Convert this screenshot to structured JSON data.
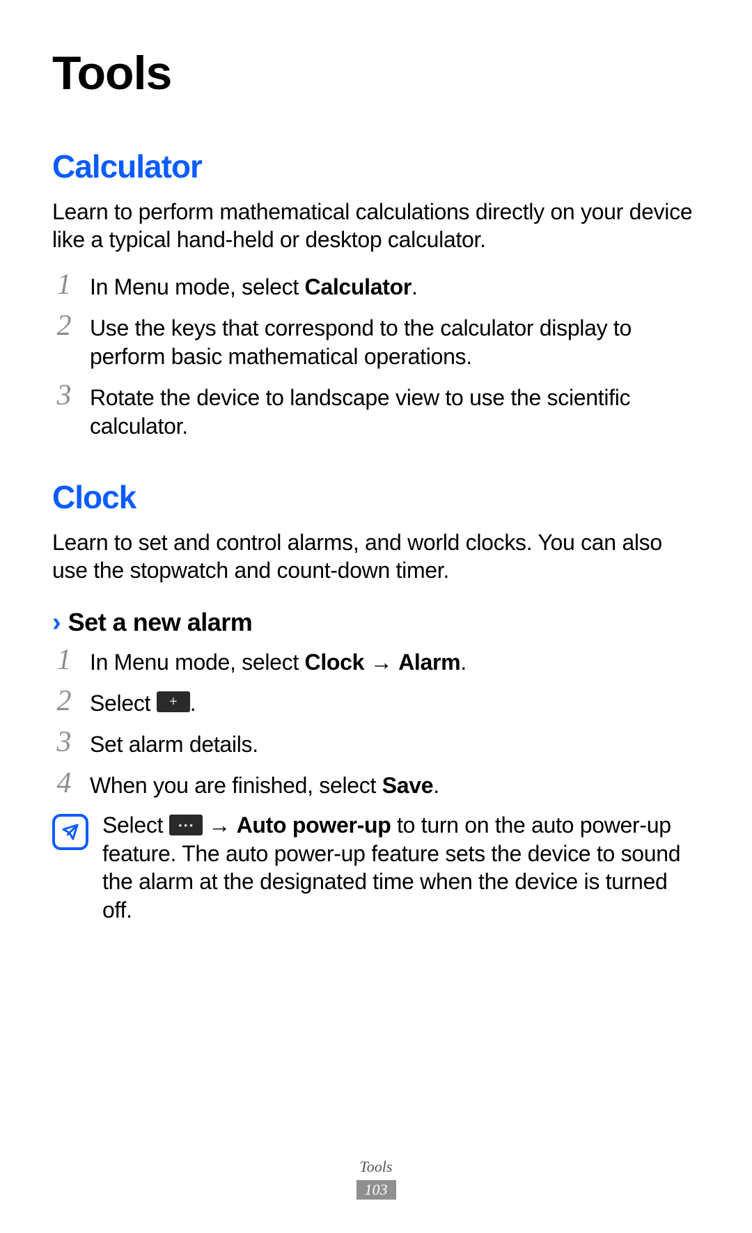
{
  "chapter_title": "Tools",
  "calculator": {
    "heading": "Calculator",
    "intro": "Learn to perform mathematical calculations directly on your device like a typical hand-held or desktop calculator.",
    "steps": [
      {
        "pre": "In Menu mode, select ",
        "bold": "Calculator",
        "post": "."
      },
      {
        "text": "Use the keys that correspond to the calculator display to perform basic mathematical operations."
      },
      {
        "text": "Rotate the device to landscape view to use the scientific calculator."
      }
    ]
  },
  "clock": {
    "heading": "Clock",
    "intro": "Learn to set and control alarms, and world clocks. You can also use the stopwatch and count-down timer.",
    "sub_heading": "Set a new alarm",
    "steps": {
      "s1_pre": "In Menu mode, select ",
      "s1_b1": "Clock",
      "s1_arrow": " → ",
      "s1_b2": "Alarm",
      "s1_post": ".",
      "s2_pre": "Select ",
      "s2_post": ".",
      "s3": "Set alarm details.",
      "s4_pre": "When you are finished, select ",
      "s4_bold": "Save",
      "s4_post": "."
    },
    "note": {
      "pre": "Select ",
      "arrow": " → ",
      "bold": "Auto power-up",
      "post": " to turn on the auto power-up feature. The auto power-up feature sets the device to sound the alarm at the designated time when the device is turned off."
    }
  },
  "footer": {
    "section": "Tools",
    "page": "103"
  },
  "icons": {
    "plus": "+",
    "more": "•••"
  }
}
